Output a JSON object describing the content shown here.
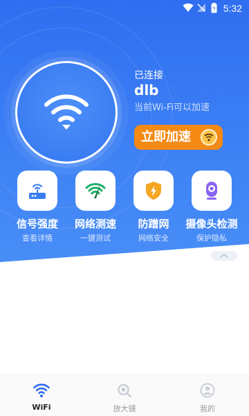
{
  "status_bar": {
    "time": "5:32"
  },
  "connection": {
    "status_label": "已连接",
    "ssid": "dlb",
    "hint": "当前Wi-Fi可以加速",
    "boost_label": "立即加速"
  },
  "features": [
    {
      "title": "信号强度",
      "subtitle": "查看详情",
      "icon": "router-icon"
    },
    {
      "title": "网络测速",
      "subtitle": "一键测试",
      "icon": "speed-test-icon"
    },
    {
      "title": "防蹭网",
      "subtitle": "网络安全",
      "icon": "shield-icon"
    },
    {
      "title": "摄像头检测",
      "subtitle": "保护隐私",
      "icon": "camera-icon"
    }
  ],
  "bottom_nav": [
    {
      "label": "WiFi",
      "icon": "wifi-icon",
      "active": true
    },
    {
      "label": "放大镜",
      "icon": "magnifier-icon",
      "active": false
    },
    {
      "label": "我的",
      "icon": "profile-icon",
      "active": false
    }
  ],
  "colors": {
    "hero_blue": "#3b7ef3",
    "boost_orange": "#f48a14",
    "feature_green": "#1fae6a",
    "feature_amber": "#f5a623",
    "feature_purple": "#8a63f0",
    "nav_active": "#2f6ef0"
  }
}
